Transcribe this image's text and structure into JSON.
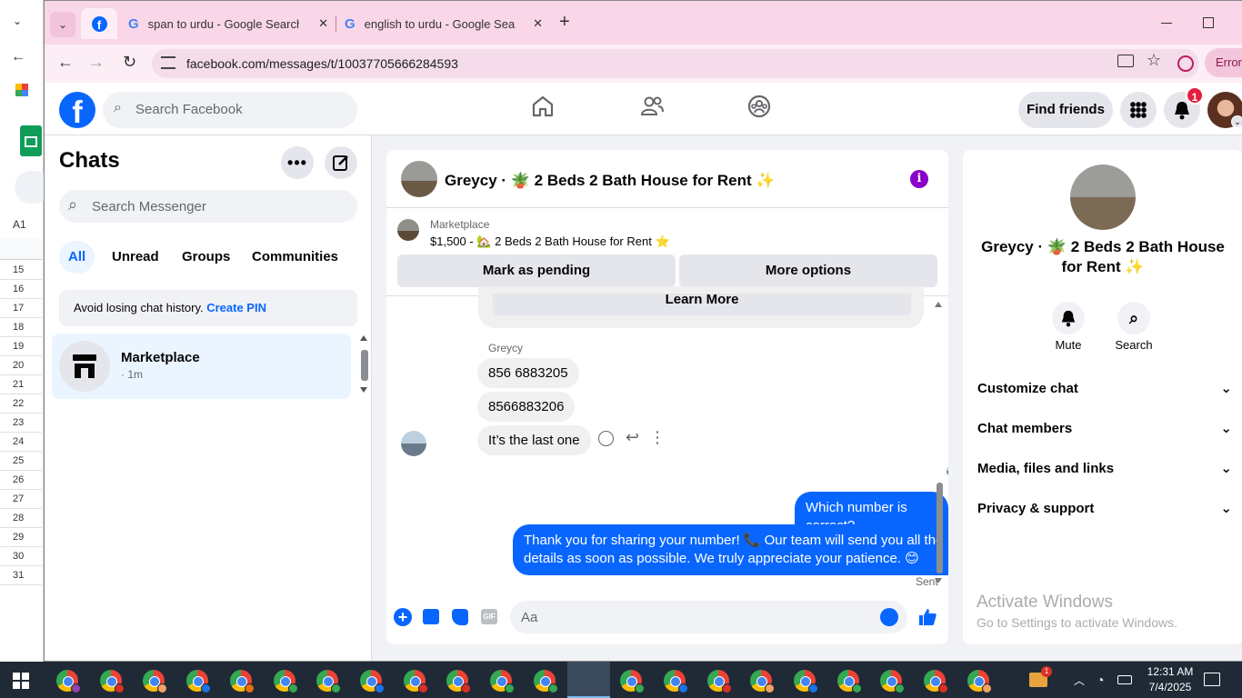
{
  "background_window": {
    "cell_ref": "A1",
    "rows": [
      "15",
      "16",
      "17",
      "18",
      "19",
      "20",
      "21",
      "22",
      "23",
      "24",
      "25",
      "26",
      "27",
      "28",
      "29",
      "30",
      "31"
    ]
  },
  "browser": {
    "tabs": [
      {
        "label": "span to urdu - Google Search"
      },
      {
        "label": "english to urdu - Google Search"
      }
    ],
    "url": "facebook.com/messages/t/10037705666284593",
    "error_label": "Error"
  },
  "facebook": {
    "search_placeholder": "Search Facebook",
    "find_friends": "Find friends",
    "notification_count": "1"
  },
  "sidebar": {
    "title": "Chats",
    "search_placeholder": "Search Messenger",
    "filters": [
      "All",
      "Unread",
      "Groups",
      "Communities"
    ],
    "pin_notice_text": "Avoid losing chat history.",
    "pin_notice_link": "Create PIN",
    "conversations": [
      {
        "name": "Marketplace",
        "meta": "· 1m"
      }
    ]
  },
  "thread": {
    "title": "Greycy · 🪴 2 Beds 2 Bath House for Rent ✨",
    "listing_label": "Marketplace",
    "listing_detail": "$1,500 - 🏡 2 Beds 2 Bath House for Rent ⭐",
    "mark_pending": "Mark as pending",
    "more_options": "More options",
    "learn_more": "Learn More",
    "sender_name": "Greycy",
    "incoming": [
      "856 6883205",
      "8566883206",
      "It’s the last one"
    ],
    "outgoing": [
      "Which number is correct?",
      "Thank you for sharing your number! 📞 Our team will send you all the details as soon as possible. We truly appreciate your patience. 😊"
    ],
    "status": "Sent",
    "composer_placeholder": "Aa",
    "gif_label": "GIF"
  },
  "info_panel": {
    "title": "Greycy · 🪴 2 Beds 2 Bath House for Rent ✨",
    "mute": "Mute",
    "search": "Search",
    "sections": [
      "Customize chat",
      "Chat members",
      "Media, files and links",
      "Privacy & support"
    ]
  },
  "watermark": {
    "line1": "Activate Windows",
    "line2": "Go to Settings to activate Windows."
  },
  "taskbar": {
    "time": "12:31 AM",
    "date": "7/4/2025",
    "tray_badge": "1",
    "badge_colors": [
      "#8e44ad",
      "#d93025",
      "#f4a261",
      "#1a73e8",
      "#e8710a",
      "#34a853",
      "#34a853",
      "#1a73e8",
      "#d93025",
      "#d93025",
      "#34a853",
      "#34a853",
      "#d93025",
      "#34a853",
      "#1a73e8",
      "#d93025",
      "#f4a261",
      "#1a73e8",
      "#34a853",
      "#34a853",
      "#d93025",
      "#f4a261"
    ]
  },
  "colors": {
    "fb_blue": "#0866ff",
    "tab_pink": "#f9d6e8",
    "purple": "#8a00c8"
  }
}
